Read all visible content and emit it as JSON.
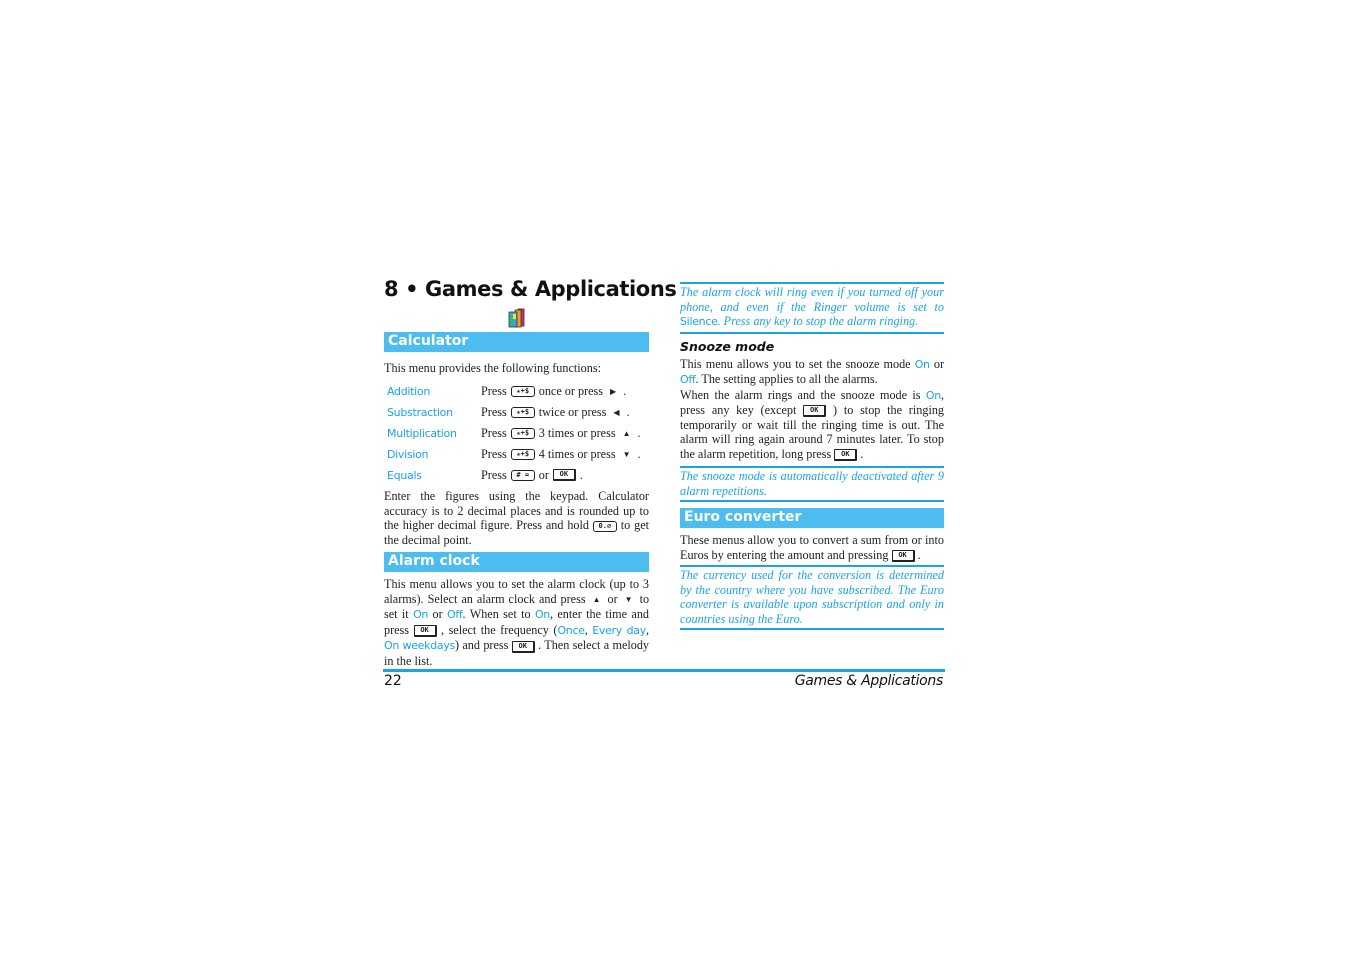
{
  "chapter": {
    "title": "8 • Games & Applications",
    "icon": "books-icon"
  },
  "calculator": {
    "heading": "Calculator",
    "intro": "This menu provides the following functions:",
    "functions": [
      {
        "name": "Addition",
        "press": "Press",
        "key": "★+$",
        "suffix": "once or press",
        "arrow": "▶",
        "end": "."
      },
      {
        "name": "Substraction",
        "press": "Press",
        "key": "★+$",
        "suffix": "twice or press",
        "arrow": "◀",
        "end": "."
      },
      {
        "name": "Multiplication",
        "press": "Press",
        "key": "★+$",
        "suffix": "3 times or press",
        "arrow": "▲",
        "end": "."
      },
      {
        "name": "Division",
        "press": "Press",
        "key": "★+$",
        "suffix": "4 times or press",
        "arrow": "▼",
        "end": "."
      },
      {
        "name": "Equals",
        "press": "Press",
        "key": "# =",
        "suffix": "or",
        "key2": "OK",
        "end": "."
      }
    ],
    "body_a": "Enter the figures using the keypad. Calculator accuracy is to 2 decimal places and is rounded up to the higher decimal figure. Press and hold",
    "key_decimal": "0.⌀",
    "body_b": "to get the decimal point."
  },
  "alarm": {
    "heading": "Alarm clock",
    "t1": "This menu allows you to set the alarm clock (up to 3 alarms). Select an alarm clock and press",
    "up": "▲",
    "or": "or",
    "down": "▼",
    "t2": "to set it",
    "on": "On",
    "or2": "or",
    "off": "Off",
    "t3": ". When set to",
    "on2": "On",
    "t4": ", enter the time and press",
    "ok": "OK",
    "t5": ", select the frequency (",
    "once": "Once",
    "comma1": ",",
    "everyday": "Every day",
    "comma2": ",",
    "weekdays": "On weekdays",
    "t6": ") and press",
    "t7": ". Then select a melody in the list."
  },
  "right": {
    "note1_a": "The alarm clock will ring even if you turned off your phone, and even if the Ringer volume is set to",
    "note1_silence": "Silence",
    "note1_b": ". Press any key to stop the alarm ringing.",
    "snooze_heading": "Snooze mode",
    "s1": "This menu allows you to set the snooze mode",
    "on": "On",
    "or": "or",
    "off": "Off",
    "s2": ". The setting applies to all the alarms.",
    "s3": "When the alarm rings and the snooze mode is",
    "on2": "On",
    "s4": ", press any key (except",
    "ok": "OK",
    "s5": ") to stop the ringing temporarily or wait till the ringing time is out. The alarm will ring again around 7 minutes later. To stop the alarm repetition, long press",
    "s6": ".",
    "note2": "The snooze mode is automatically deactivated after 9 alarm repetitions.",
    "euro_heading": "Euro converter",
    "e1": "These menus allow you to convert a sum from or into Euros by entering the amount and pressing",
    "e2": ".",
    "note3": "The currency used for the conversion is determined by the country where you have subscribed. The Euro converter is available upon subscription and only in countries using the Euro."
  },
  "footer": {
    "page_number": "22",
    "running_title": "Games & Applications"
  },
  "colors": {
    "accent": "#1aa3e8",
    "section_bar": "#4dbdf0"
  }
}
